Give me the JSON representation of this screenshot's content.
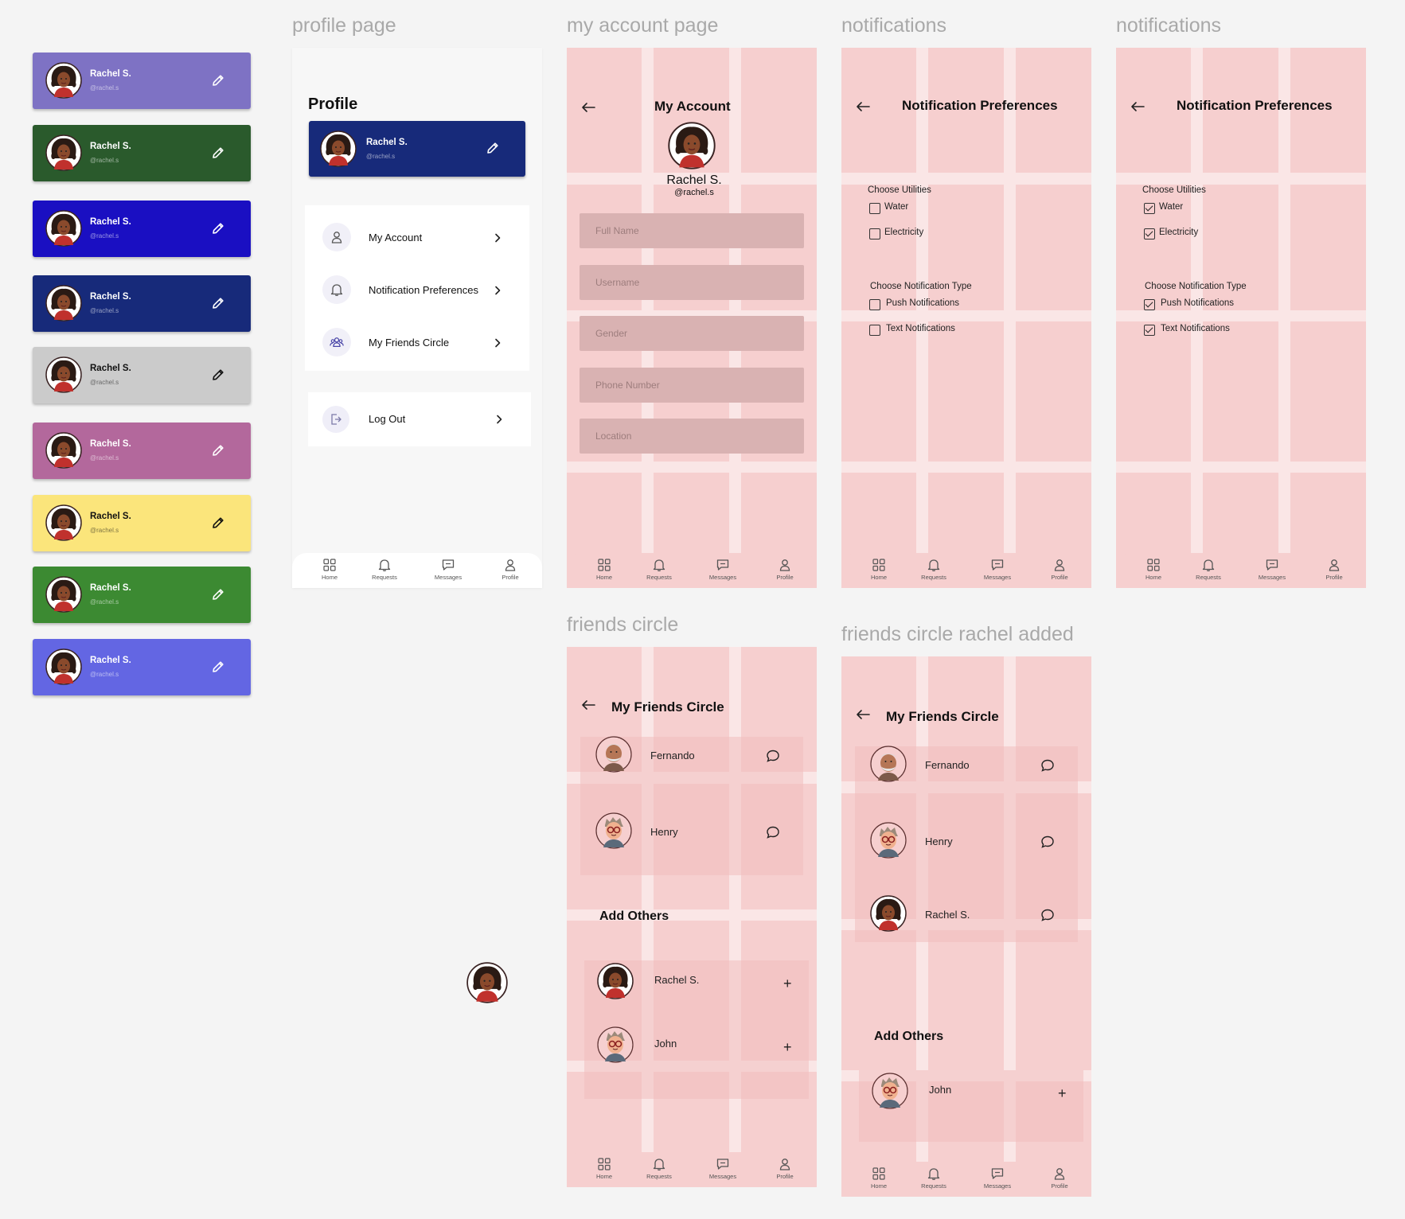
{
  "frame_labels": {
    "profile": "profile page",
    "account": "my account page",
    "notif1": "notifications",
    "notif2": "notifications",
    "friends": "friends circle",
    "friends_added": "friends circle rachel added"
  },
  "user": {
    "name": "Rachel S.",
    "handle": "@rachel.s"
  },
  "card_variants": [
    {
      "bg": "#7e72c4",
      "fg": "#ffffff"
    },
    {
      "bg": "#2a5a2c",
      "fg": "#ffffff"
    },
    {
      "bg": "#1a0fc2",
      "fg": "#ffffff"
    },
    {
      "bg": "#172a7a",
      "fg": "#ffffff"
    },
    {
      "bg": "#cbcbcb",
      "fg": "#111111"
    },
    {
      "bg": "#b3689c",
      "fg": "#ffffff"
    },
    {
      "bg": "#fbe57b",
      "fg": "#111111"
    },
    {
      "bg": "#3c8a32",
      "fg": "#ffffff"
    },
    {
      "bg": "#6366e3",
      "fg": "#ffffff"
    }
  ],
  "profile_page": {
    "title": "Profile",
    "card_bg": "#172a7a",
    "menu": [
      {
        "label": "My Account",
        "icon": "user-icon"
      },
      {
        "label": "Notification Preferences",
        "icon": "bell-icon"
      },
      {
        "label": "My Friends Circle",
        "icon": "group-icon"
      }
    ],
    "logout": {
      "label": "Log Out",
      "icon": "logout-icon"
    }
  },
  "nav": [
    {
      "label": "Home",
      "icon": "grid-icon"
    },
    {
      "label": "Requests",
      "icon": "bell-icon"
    },
    {
      "label": "Messages",
      "icon": "chat-icon"
    },
    {
      "label": "Profile",
      "icon": "user-icon"
    }
  ],
  "account_page": {
    "title": "My Account",
    "name": "Rachel S.",
    "handle": "@rachel.s",
    "fields": [
      {
        "placeholder": "Full Name"
      },
      {
        "placeholder": "Username"
      },
      {
        "placeholder": "Gender"
      },
      {
        "placeholder": "Phone Number"
      },
      {
        "placeholder": "Location"
      }
    ]
  },
  "notifications_page": {
    "title": "Notification Preferences",
    "utilities_label": "Choose Utilities",
    "utilities": [
      "Water",
      "Electricity"
    ],
    "type_label": "Choose Notification Type",
    "types": [
      "Push Notifications",
      "Text Notifications"
    ],
    "unchecked_state": [
      false,
      false,
      false,
      false
    ],
    "checked_state": [
      true,
      true,
      true,
      true
    ]
  },
  "friends_page": {
    "title": "My Friends Circle",
    "friends": [
      "Fernando",
      "Henry"
    ],
    "add_others_label": "Add Others",
    "others": [
      "Rachel S.",
      "John"
    ]
  },
  "friends_added_page": {
    "title": "My Friends Circle",
    "friends": [
      "Fernando",
      "Henry",
      "Rachel S."
    ],
    "add_others_label": "Add Others",
    "others": [
      "John"
    ]
  }
}
